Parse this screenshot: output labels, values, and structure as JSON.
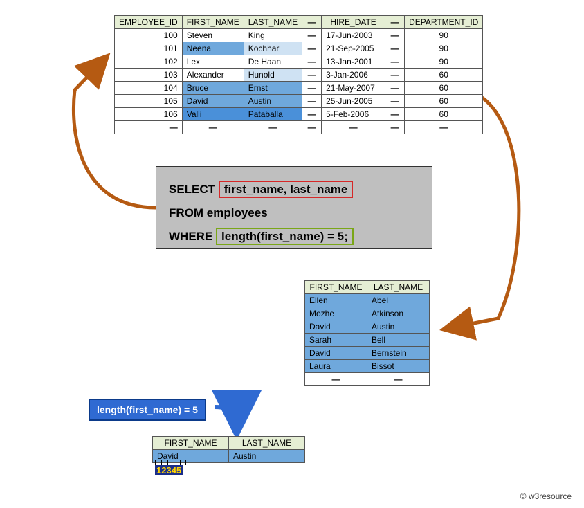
{
  "top_table": {
    "headers": [
      "EMPLOYEE_ID",
      "FIRST_NAME",
      "LAST_NAME",
      "—",
      "HIRE_DATE",
      "—",
      "DEPARTMENT_ID"
    ],
    "rows": [
      {
        "id": "100",
        "fn": "Steven",
        "ln": "King",
        "hd": "17-Jun-2003",
        "dept": "90",
        "shade": {
          "fn": "",
          "ln": ""
        }
      },
      {
        "id": "101",
        "fn": "Neena",
        "ln": "Kochhar",
        "hd": "21-Sep-2005",
        "dept": "90",
        "shade": {
          "fn": "hl3",
          "ln": "hl1"
        }
      },
      {
        "id": "102",
        "fn": "Lex",
        "ln": "De Haan",
        "hd": "13-Jan-2001",
        "dept": "90",
        "shade": {
          "fn": "",
          "ln": ""
        }
      },
      {
        "id": "103",
        "fn": "Alexander",
        "ln": "Hunold",
        "hd": "3-Jan-2006",
        "dept": "60",
        "shade": {
          "fn": "",
          "ln": "hl1"
        }
      },
      {
        "id": "104",
        "fn": "Bruce",
        "ln": "Ernst",
        "hd": "21-May-2007",
        "dept": "60",
        "shade": {
          "fn": "hl3",
          "ln": "hl3"
        }
      },
      {
        "id": "105",
        "fn": "David",
        "ln": "Austin",
        "hd": "25-Jun-2005",
        "dept": "60",
        "shade": {
          "fn": "hl3",
          "ln": "hl3"
        }
      },
      {
        "id": "106",
        "fn": "Valli",
        "ln": "Pataballa",
        "hd": "5-Feb-2006",
        "dept": "60",
        "shade": {
          "fn": "hl4",
          "ln": "hl4"
        }
      }
    ]
  },
  "sql": {
    "line1_kw": "SELECT",
    "line1_cols": "first_name, last_name",
    "line2": "FROM employees",
    "line3_kw": "WHERE",
    "line3_expr": "length(first_name) = 5;"
  },
  "mid_table": {
    "headers": [
      "FIRST_NAME",
      "LAST_NAME"
    ],
    "rows": [
      {
        "fn": "Ellen",
        "ln": "Abel"
      },
      {
        "fn": "Mozhe",
        "ln": "Atkinson"
      },
      {
        "fn": "David",
        "ln": "Austin"
      },
      {
        "fn": "Sarah",
        "ln": "Bell"
      },
      {
        "fn": "David",
        "ln": "Bernstein"
      },
      {
        "fn": "Laura",
        "ln": "Bissot"
      }
    ]
  },
  "criterion": "length(first_name) = 5",
  "bot_table": {
    "headers": [
      "FIRST_NAME",
      "LAST_NAME"
    ],
    "row": {
      "fn": "David",
      "ln": "Austin"
    }
  },
  "counter": "12345",
  "credit": "w3resource"
}
